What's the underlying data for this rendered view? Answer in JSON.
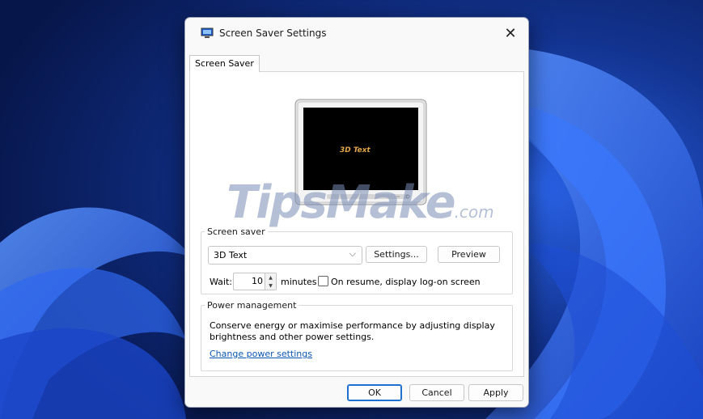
{
  "dialog": {
    "title": "Screen Saver Settings",
    "close_label": "✕",
    "tab_label": "Screen Saver"
  },
  "preview": {
    "monitor_text": "3D Text"
  },
  "screen_saver": {
    "legend": "Screen saver",
    "selected": "3D Text",
    "settings_label": "Settings...",
    "preview_label": "Preview",
    "wait_label": "Wait:",
    "wait_value": "10",
    "minutes_label": "minutes",
    "resume_label": "On resume, display log-on screen",
    "resume_checked": false
  },
  "power": {
    "legend": "Power management",
    "description": "Conserve energy or maximise performance by adjusting display brightness and other power settings.",
    "link_label": "Change power settings"
  },
  "buttons": {
    "ok": "OK",
    "cancel": "Cancel",
    "apply": "Apply"
  },
  "watermark": {
    "main": "TipsMake",
    "suffix": ".com"
  },
  "colors": {
    "wallpaper_dark": "#0a1c5e",
    "wallpaper_bloom": "#2f6df5",
    "link": "#0b57b5",
    "default_button_border": "#1e6fd0"
  }
}
